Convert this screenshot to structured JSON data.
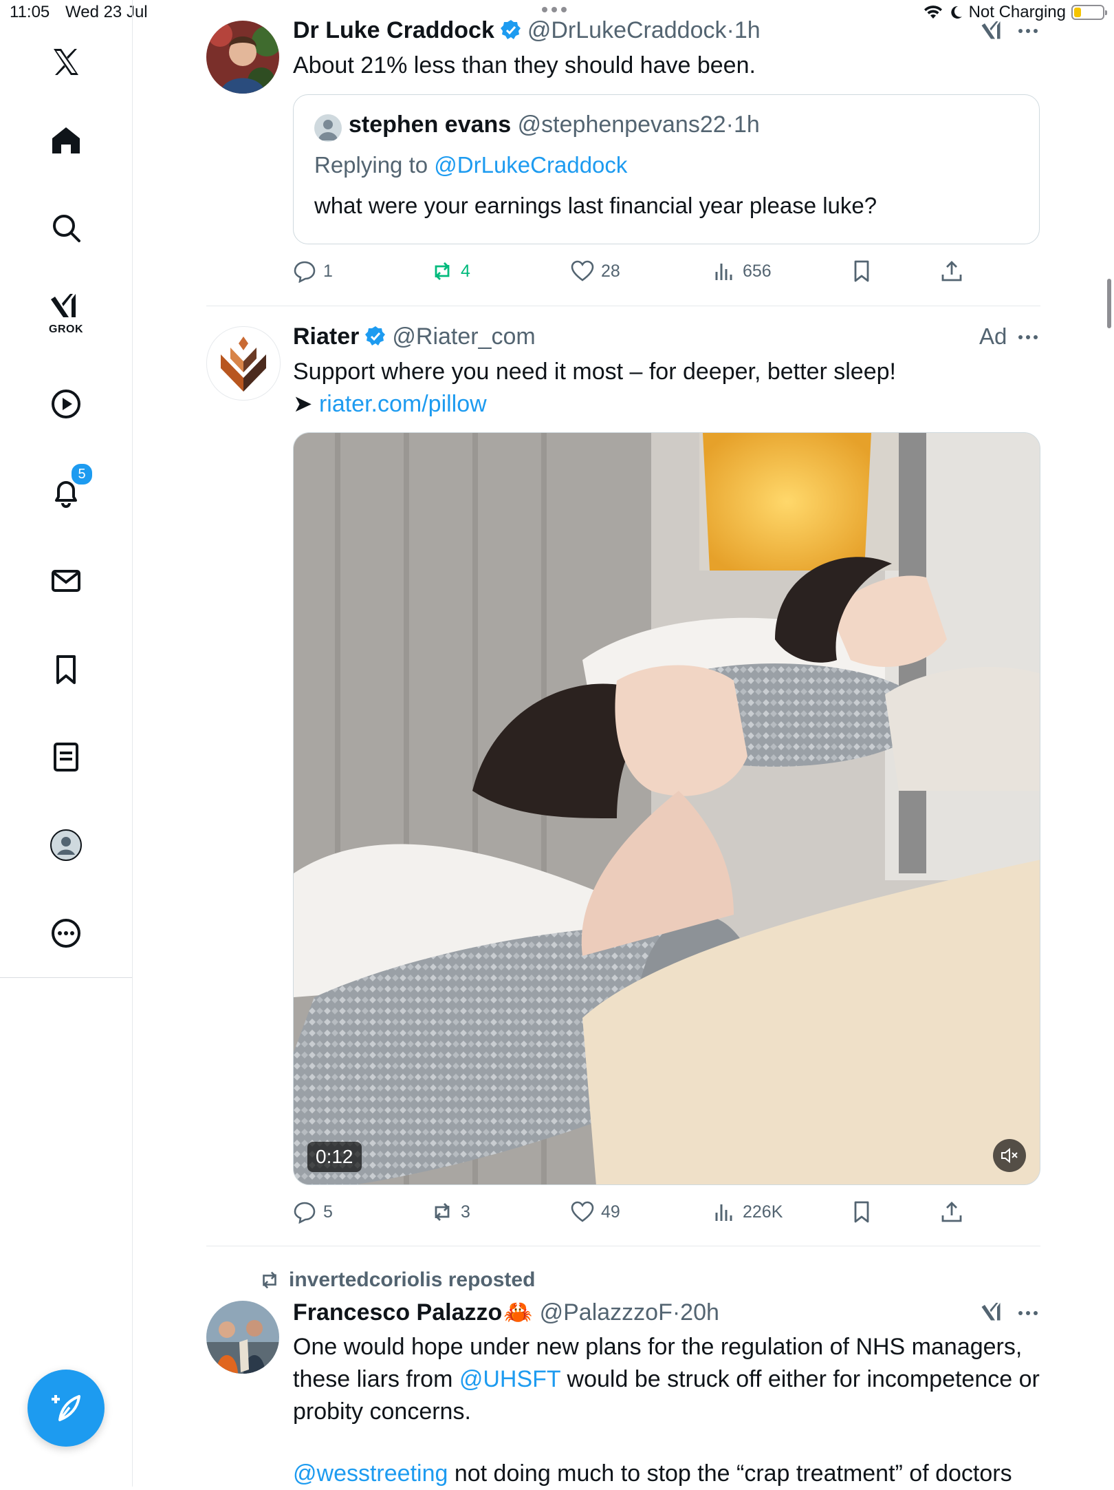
{
  "status_bar": {
    "time": "11:05",
    "date": "Wed 23 Jul",
    "charging": "Not Charging",
    "battery_level": 0.25
  },
  "sidebar": {
    "items": [
      {
        "name": "x-logo",
        "icon": "x-logo-icon"
      },
      {
        "name": "home",
        "icon": "home-icon"
      },
      {
        "name": "explore",
        "icon": "search-icon"
      },
      {
        "name": "grok",
        "icon": "grok-icon",
        "label": "GROK"
      },
      {
        "name": "video",
        "icon": "play-icon"
      },
      {
        "name": "notifications",
        "icon": "bell-icon",
        "badge": "5"
      },
      {
        "name": "messages",
        "icon": "mail-icon"
      },
      {
        "name": "bookmarks",
        "icon": "bookmark-icon"
      },
      {
        "name": "lists",
        "icon": "list-icon"
      },
      {
        "name": "profile",
        "icon": "profile-icon"
      },
      {
        "name": "more",
        "icon": "more-circle-icon"
      }
    ],
    "compose": {
      "icon": "compose-icon"
    }
  },
  "tweets": [
    {
      "name": "Dr Luke Craddock",
      "verified": true,
      "handle": "@DrLukeCraddock",
      "time": "1h",
      "text": "About 21% less than they should have been.",
      "quote": {
        "name": "stephen evans",
        "handle": "@stephenpevans22",
        "time": "1h",
        "replying_prefix": "Replying to",
        "replying_to": "@DrLukeCraddock",
        "text": "what were your earnings last financial year please luke?"
      },
      "actions": {
        "replies": "1",
        "reposts": "4",
        "likes": "28",
        "views": "656"
      }
    },
    {
      "name": "Riater",
      "verified": true,
      "handle": "@Riater_com",
      "ad_label": "Ad",
      "text": "Support where you need it most – for deeper, better sleep!",
      "arrow": "➤",
      "link": "riater.com/pillow",
      "video_duration": "0:12",
      "actions": {
        "replies": "5",
        "reposts": "3",
        "likes": "49",
        "views": "226K"
      }
    },
    {
      "repost_by": "invertedcoriolis reposted",
      "name": "Francesco Palazzo",
      "emoji": "🦀",
      "handle": "@PalazzzoF",
      "time": "20h",
      "text_1a": "One would hope under new plans for the regulation of NHS managers, these liars from ",
      "mention_1": "@UHSFT",
      "text_1b": " would be struck off either for incompetence or  probity concerns.",
      "mention_2": "@wesstreeting",
      "text_2": " not doing much to stop the “crap treatment” of doctors"
    }
  ],
  "colors": {
    "accent": "#1d9bf0",
    "repost_green": "#00ba7c",
    "text_secondary": "#536471"
  }
}
